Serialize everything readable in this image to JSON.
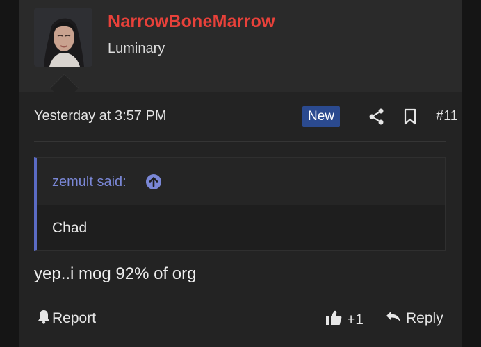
{
  "post": {
    "username": "NarrowBoneMarrow",
    "user_title": "Luminary",
    "timestamp": "Yesterday at 3:57 PM",
    "new_badge": "New",
    "post_number": "#11",
    "quote": {
      "attribution": "zemult said:",
      "body": "Chad"
    },
    "message": "yep..i mog 92% of org",
    "actions": {
      "report_label": "Report",
      "like_count": "+1",
      "reply_label": "Reply"
    }
  },
  "colors": {
    "username": "#e8413a",
    "badge_bg": "#2b4a8f",
    "quote_accent": "#5b6bc4",
    "background": "#232323"
  },
  "icons": [
    "share-icon",
    "bookmark-icon",
    "arrow-up-circle-icon",
    "bell-icon",
    "thumbs-up-icon",
    "reply-icon"
  ]
}
